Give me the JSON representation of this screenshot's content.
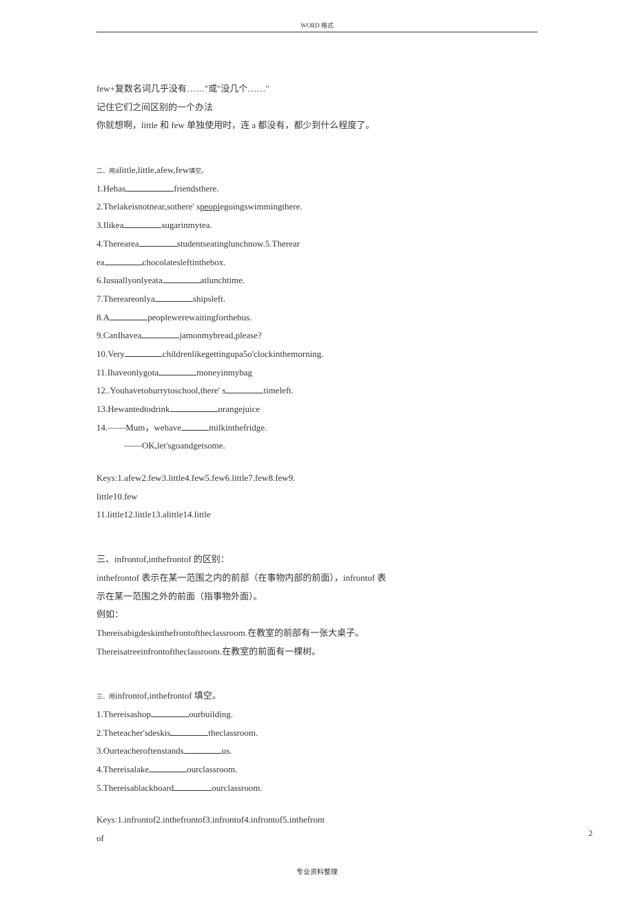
{
  "header": "WORD 格式",
  "intro": {
    "line1": "few+复数名词几乎没有……\"或\"没几个……\"",
    "line2": "记住它们之间区别的一个办法",
    "line3": "你就想啊，little 和 few 单独使用时，连 a 都没有，都少到什么程度了。"
  },
  "section2": {
    "prefix": "二、用",
    "words": "alittle,little,afew,few",
    "suffix": "填空。",
    "items": {
      "q1a": "1.Hehas",
      "q1b": "friendsthere.",
      "q2a": "2.Thelakeisnotnear,sothere' s",
      "q2b": "peopl",
      "q2c": "egoingswimmingthere.",
      "q3a": "3.Ilikea",
      "q3b": "sugarinmytea.",
      "q4a": "4.Therearea",
      "q4b": "studentseatinglunchnow.5.Therear",
      "q5a": "ea",
      "q5b": "chocolatesleftinthebox.",
      "q6a": "6.Iusuallyonlyeata",
      "q6b": "atlunchtime.",
      "q7a": "7.Thereareonlya",
      "q7b": "shipsleft.",
      "q8a": "8.A",
      "q8b": "peoplewerewaitingforthebus.",
      "q9a": "9.CanIhavea",
      "q9b": "jamonmybread,please?",
      "q10a": "10.Very",
      "q10b": "childrenlikegettingupa5o'clockinthemorning.",
      "q11a": "11.Ihaveonlygota",
      "q11b": "moneyinmybag",
      "q12a": "12..Youhavetohurrytoschool,there' s",
      "q12b": "timeleft.",
      "q13a": "13.Hewantedtodrink",
      "q13b": "orangejuice",
      "q14a": "14.——Mum，wehave",
      "q14b": "milkinthefridge.",
      "q14c": "——OK,let'sgoandgetsome."
    },
    "keys": {
      "line1": "Keys:1.afew2.few3.little4.few5.few6.little7.few8.few9.",
      "line2": "little10.few",
      "line3": "11.little12.little13.alittle14.little"
    }
  },
  "section3": {
    "title": "三、infrontof,inthefrontof 的区别：",
    "desc1": "inthefrontof 表示在某一范围之内的前部（在事物内部的前面），infrontof 表",
    "desc2": "示在某一范围之外的前面（指事物外面）。",
    "example_label": "例如：",
    "ex1": "Thereisabigdeskinthefrontoftheclassroom.在教室的前部有一张大桌子。",
    "ex2": "Thereisatreeinfrontoftheclassroom.在教室的前面有一棵树。"
  },
  "section3b": {
    "prefix": "三、用",
    "words": "infrontof,inthefrontof 填空。",
    "items": {
      "q1a": "1.Thereisashop",
      "q1b": "ourbuilding.",
      "q2a": "2.Theteacher'sdeskis",
      "q2b": "theclassroom.",
      "q3a": "3.Ourteacheroftenstands",
      "q3b": "us.",
      "q4a": "4.Thereisalake",
      "q4b": "ourclassroom.",
      "q5a": "5.Thereisablackboard",
      "q5b": "ourclassroom."
    },
    "keys": {
      "line1": "Keys:1.infrontof2.inthefrontof3.infrontof4.infrontof5.inthefront",
      "line2": "of"
    }
  },
  "page_number": "2",
  "footer": "专业资料整理"
}
